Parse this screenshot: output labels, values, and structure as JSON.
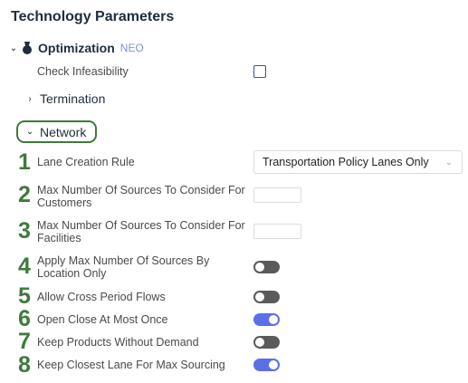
{
  "page_title": "Technology Parameters",
  "optimization": {
    "label": "Optimization",
    "badge": "NEO"
  },
  "check_infeasibility": {
    "label": "Check Infeasibility",
    "checked": false
  },
  "termination": {
    "label": "Termination"
  },
  "network": {
    "label": "Network"
  },
  "items": [
    {
      "number": "1",
      "label": "Lane Creation Rule",
      "control": "select",
      "value": "Transportation Policy Lanes Only"
    },
    {
      "number": "2",
      "label": "Max Number Of Sources To Consider For Customers",
      "control": "input",
      "value": ""
    },
    {
      "number": "3",
      "label": "Max Number Of Sources To Consider For Facilities",
      "control": "input",
      "value": ""
    },
    {
      "number": "4",
      "label": "Apply Max Number Of Sources By Location Only",
      "control": "toggle",
      "on": false
    },
    {
      "number": "5",
      "label": "Allow Cross Period Flows",
      "control": "toggle",
      "on": false
    },
    {
      "number": "6",
      "label": "Open Close At Most Once",
      "control": "toggle",
      "on": true
    },
    {
      "number": "7",
      "label": "Keep Products Without Demand",
      "control": "toggle",
      "on": false
    },
    {
      "number": "8",
      "label": "Keep Closest Lane For Max Sourcing",
      "control": "toggle",
      "on": true
    }
  ],
  "colors": {
    "accent": "#5a6fe8",
    "annotation": "#3e7a3a",
    "neo": "#7f8fd8"
  }
}
